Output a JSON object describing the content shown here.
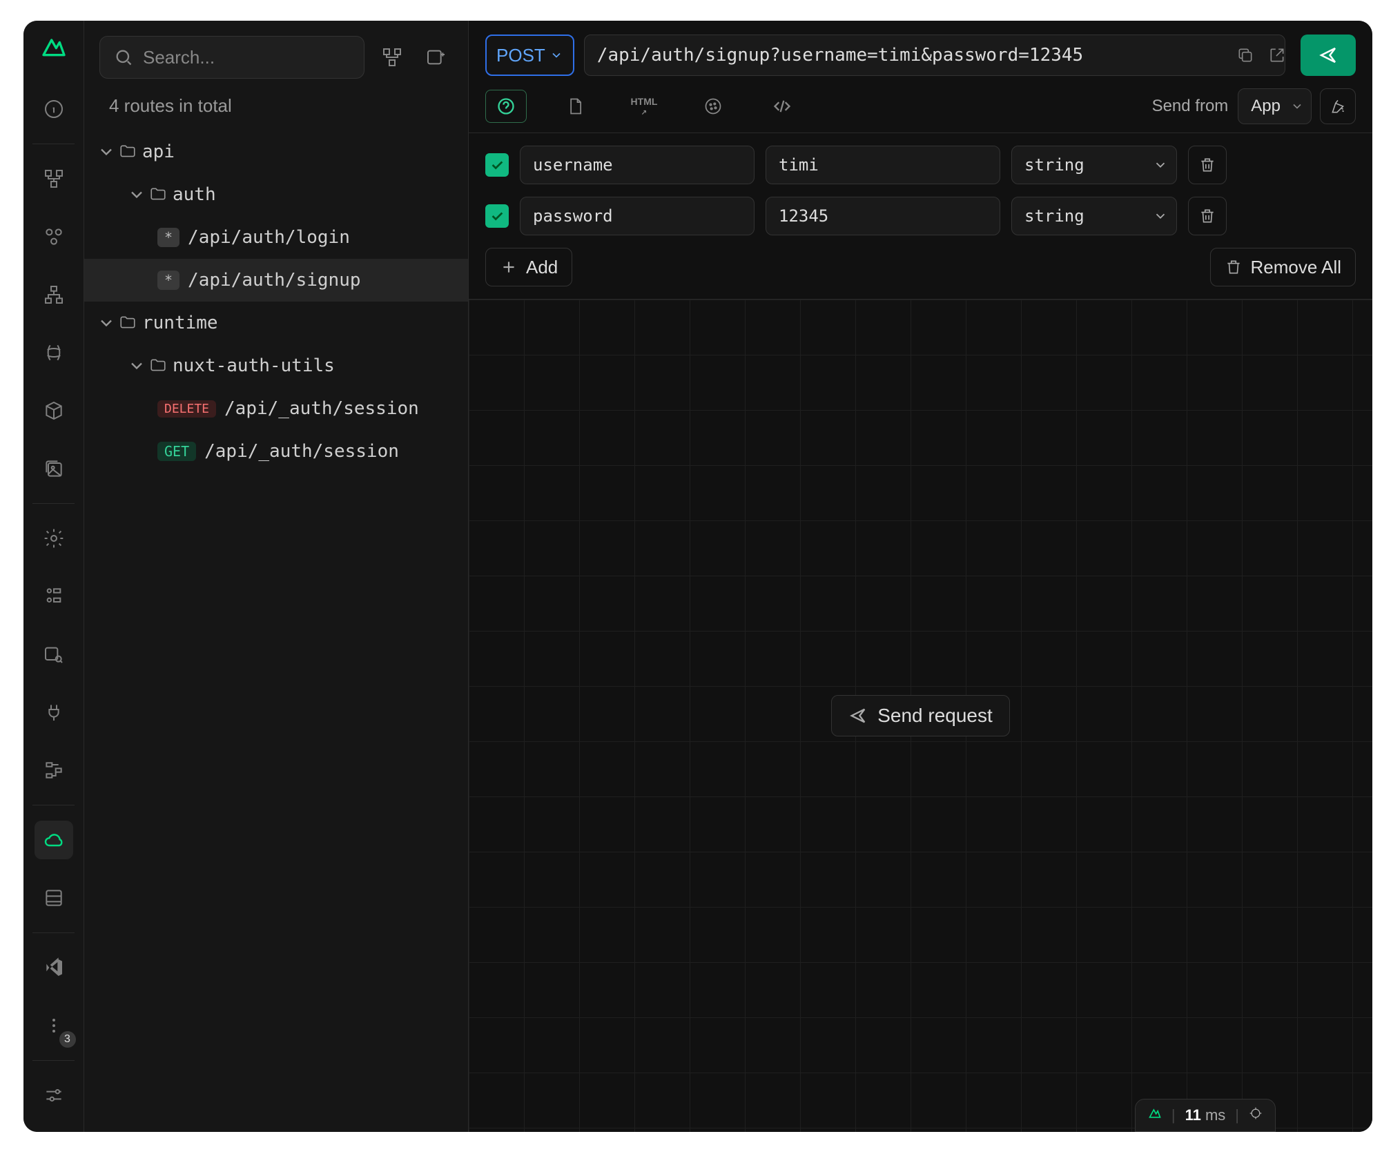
{
  "rail": {
    "badge_count": "3"
  },
  "sidebar": {
    "search_placeholder": "Search...",
    "route_count_label": "4 routes in total",
    "groups": [
      {
        "label": "api",
        "children": [
          {
            "label": "auth",
            "routes": [
              {
                "method": "*",
                "path": "/api/auth/login"
              },
              {
                "method": "*",
                "path": "/api/auth/signup"
              }
            ]
          }
        ]
      },
      {
        "label": "runtime",
        "children": [
          {
            "label": "nuxt-auth-utils",
            "routes": [
              {
                "method": "DELETE",
                "path": "/api/_auth/session"
              },
              {
                "method": "GET",
                "path": "/api/_auth/session"
              }
            ]
          }
        ]
      }
    ]
  },
  "request": {
    "method": "POST",
    "url": "/api/auth/signup?username=timi&password=12345",
    "send_from_label": "Send from",
    "send_from_value": "App"
  },
  "params": {
    "rows": [
      {
        "enabled": true,
        "key": "username",
        "value": "timi",
        "type": "string"
      },
      {
        "enabled": true,
        "key": "password",
        "value": "12345",
        "type": "string"
      }
    ],
    "add_label": "Add",
    "remove_all_label": "Remove All"
  },
  "response": {
    "send_request_label": "Send request"
  },
  "status": {
    "timing_value": "11",
    "timing_unit": "ms"
  }
}
